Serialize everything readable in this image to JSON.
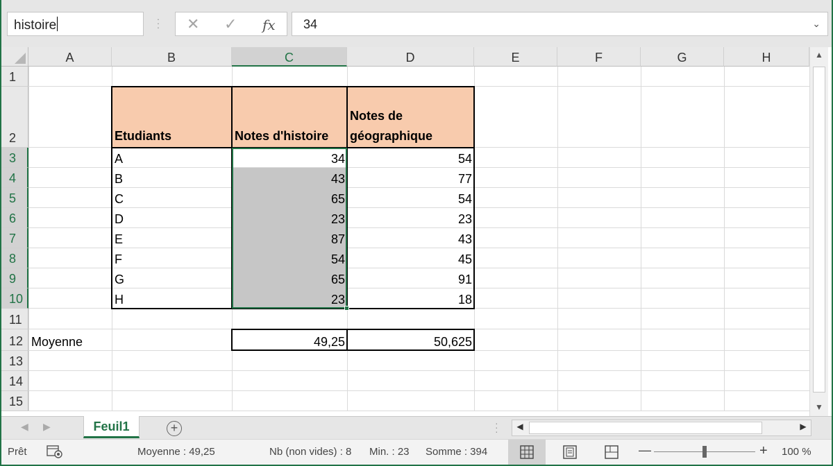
{
  "formula_bar": {
    "name_box": "histoire",
    "cancel_glyph": "✕",
    "enter_glyph": "✓",
    "fx_label": "fx",
    "formula_value": "34"
  },
  "columns": [
    "A",
    "B",
    "C",
    "D",
    "E",
    "F",
    "G",
    "H"
  ],
  "rows": [
    "1",
    "2",
    "3",
    "4",
    "5",
    "6",
    "7",
    "8",
    "9",
    "10",
    "11",
    "12",
    "13",
    "14",
    "15"
  ],
  "table": {
    "headers": [
      "Etudiants",
      "Notes d'histoire",
      "Notes de géographique"
    ],
    "students": [
      "A",
      "B",
      "C",
      "D",
      "E",
      "F",
      "G",
      "H"
    ],
    "histoire": [
      "34",
      "43",
      "65",
      "23",
      "87",
      "54",
      "65",
      "23"
    ],
    "geographie": [
      "54",
      "77",
      "54",
      "23",
      "43",
      "45",
      "91",
      "18"
    ],
    "average_label": "Moyenne",
    "average_histoire": "49,25",
    "average_geographie": "50,625"
  },
  "sheet_tabs": [
    "Feuil1"
  ],
  "status_bar": {
    "mode": "Prêt",
    "average": "Moyenne : 49,25",
    "count": "Nb (non vides) : 8",
    "min": "Min. : 23",
    "sum": "Somme : 394",
    "zoom_minus": "—",
    "zoom_plus": "+",
    "zoom": "100 %"
  },
  "colors": {
    "accent": "#217346",
    "header_fill": "#f8cbad",
    "selection_fill": "#c6c6c6"
  },
  "icons": [
    "cancel-icon",
    "enter-icon",
    "fx-icon",
    "dropdown-chevron-icon",
    "add-sheet-icon",
    "normal-view-icon",
    "page-layout-icon",
    "page-break-icon",
    "accessibility-icon"
  ]
}
